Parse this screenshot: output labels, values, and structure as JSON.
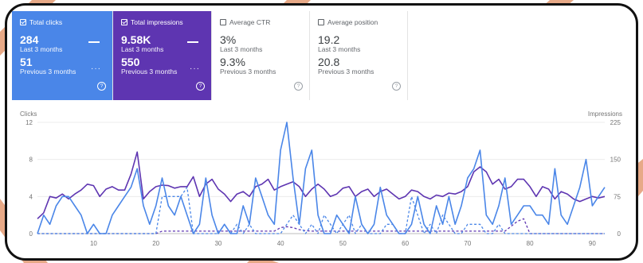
{
  "cards": [
    {
      "id": "clicks",
      "label": "Total clicks",
      "checked": true,
      "value": "284",
      "period": "Last 3 months",
      "prev_value": "51",
      "prev_period": "Previous 3 months"
    },
    {
      "id": "impr",
      "label": "Total impressions",
      "checked": true,
      "value": "9.58K",
      "period": "Last 3 months",
      "prev_value": "550",
      "prev_period": "Previous 3 months"
    },
    {
      "id": "ctr",
      "label": "Average CTR",
      "checked": false,
      "value": "3%",
      "period": "Last 3 months",
      "prev_value": "9.3%",
      "prev_period": "Previous 3 months"
    },
    {
      "id": "pos",
      "label": "Average position",
      "checked": false,
      "value": "19.2",
      "period": "Last 3 months",
      "prev_value": "20.8",
      "prev_period": "Previous 3 months"
    }
  ],
  "help_glyph": "?",
  "icons": {
    "checkbox": "checkbox-icon",
    "help": "help-circle-icon",
    "line_legend": "solid-line-icon",
    "dots_legend": "dotted-line-icon"
  },
  "colors": {
    "clicks": "#4a86e8",
    "impressions": "#5e35b1",
    "frame": "#111111",
    "background_accent": "#e39a72"
  },
  "chart_data": {
    "type": "line",
    "x_ticks": [
      10,
      20,
      30,
      40,
      50,
      60,
      70,
      80,
      90
    ],
    "left_axis": {
      "label": "Clicks",
      "ticks": [
        0,
        4,
        8,
        12
      ],
      "range": [
        0,
        12
      ]
    },
    "right_axis": {
      "label": "Impressions",
      "ticks": [
        0,
        75,
        150,
        225
      ],
      "range": [
        0,
        225
      ]
    },
    "x_range": [
      1,
      92
    ],
    "series": [
      {
        "key": "impressions",
        "axis": "right",
        "style": "solid",
        "values": [
          30,
          42,
          75,
          72,
          80,
          70,
          80,
          88,
          100,
          97,
          75,
          90,
          95,
          88,
          88,
          120,
          165,
          70,
          85,
          95,
          98,
          97,
          92,
          95,
          95,
          115,
          75,
          100,
          110,
          90,
          80,
          65,
          80,
          85,
          75,
          95,
          100,
          110,
          88,
          95,
          100,
          105,
          95,
          75,
          90,
          100,
          90,
          75,
          80,
          92,
          95,
          75,
          85,
          90,
          75,
          85,
          90,
          80,
          70,
          75,
          88,
          85,
          75,
          70,
          78,
          75,
          82,
          80,
          85,
          95,
          125,
          135,
          125,
          100,
          110,
          90,
          95,
          110,
          110,
          95,
          75,
          95,
          90,
          70,
          85,
          80,
          70,
          65,
          70,
          75,
          72,
          75
        ]
      },
      {
        "key": "clicks",
        "axis": "left",
        "style": "solid",
        "values": [
          0,
          2,
          1,
          3,
          4,
          4,
          3,
          2,
          0,
          1,
          0,
          0,
          2,
          3,
          4,
          5,
          7,
          3,
          1,
          3,
          6,
          3,
          2,
          4,
          2,
          0,
          1,
          6,
          2,
          0,
          1,
          0,
          0,
          3,
          1,
          6,
          4,
          2,
          1,
          9,
          12,
          6,
          1,
          7,
          9,
          2,
          0,
          0,
          2,
          1,
          0,
          4,
          1,
          0,
          1,
          5,
          2,
          1,
          0,
          0,
          1,
          4,
          1,
          0,
          3,
          1,
          4,
          1,
          3,
          6,
          7,
          9,
          2,
          1,
          3,
          6,
          1,
          2,
          3,
          3,
          2,
          2,
          1,
          7,
          2,
          1,
          3,
          5,
          8,
          3,
          4,
          5
        ]
      },
      {
        "key": "clicks_prev",
        "axis": "left",
        "style": "dashed",
        "values": [
          0,
          0,
          0,
          0,
          0,
          0,
          0,
          0,
          0,
          0,
          0,
          0,
          0,
          0,
          0,
          0,
          0,
          0,
          0,
          0,
          4,
          4,
          4,
          4,
          5,
          0,
          0,
          0,
          0,
          0,
          1,
          0,
          1,
          0,
          1,
          0,
          0,
          0,
          0,
          0,
          1,
          2,
          1,
          0,
          1,
          0,
          2,
          1,
          0,
          1,
          2,
          0,
          1,
          0,
          0,
          0,
          1,
          1,
          0,
          0,
          4,
          2,
          0,
          1,
          0,
          2,
          1,
          0,
          0,
          1,
          1,
          1,
          0,
          0,
          1,
          0,
          0,
          0,
          0,
          0,
          0,
          0,
          0,
          0,
          0,
          0,
          0,
          0,
          0,
          0,
          0,
          0
        ]
      },
      {
        "key": "impressions_prev",
        "axis": "right",
        "style": "dashed",
        "values": [
          0,
          0,
          0,
          0,
          0,
          0,
          0,
          0,
          0,
          0,
          0,
          0,
          0,
          0,
          0,
          0,
          0,
          0,
          0,
          0,
          5,
          5,
          5,
          5,
          5,
          5,
          5,
          5,
          5,
          5,
          5,
          5,
          5,
          5,
          5,
          5,
          5,
          5,
          5,
          12,
          14,
          12,
          8,
          6,
          5,
          5,
          5,
          5,
          5,
          5,
          5,
          5,
          5,
          5,
          5,
          5,
          5,
          5,
          5,
          5,
          5,
          5,
          5,
          5,
          5,
          5,
          5,
          5,
          5,
          5,
          5,
          5,
          5,
          5,
          5,
          5,
          15,
          25,
          30,
          0,
          0,
          0,
          0,
          0,
          0,
          0,
          0,
          0,
          0,
          0,
          0,
          0
        ]
      }
    ]
  }
}
